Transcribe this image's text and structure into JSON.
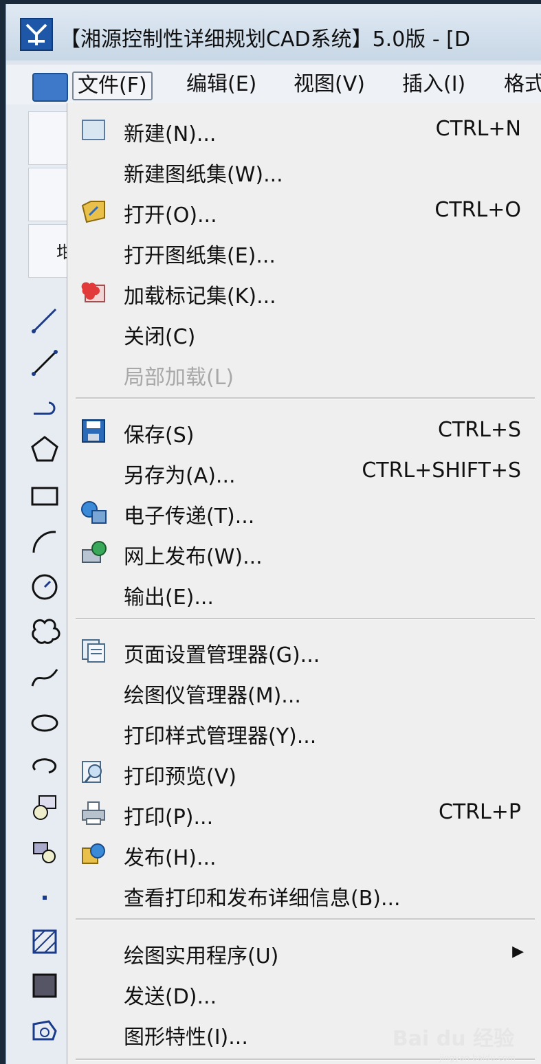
{
  "window": {
    "title": "【湘源控制性详细规划CAD系统】5.0版 - [D"
  },
  "menubar": {
    "items": [
      {
        "label": "文件(F)"
      },
      {
        "label": "编辑(E)"
      },
      {
        "label": "视图(V)"
      },
      {
        "label": "插入(I)"
      },
      {
        "label": "格式"
      }
    ]
  },
  "toolbar": {
    "partial_label": "坩"
  },
  "file_menu": {
    "items": [
      {
        "label": "新建(N)...",
        "shortcut": "CTRL+N",
        "icon": "new-document-icon"
      },
      {
        "label": "新建图纸集(W)...",
        "shortcut": ""
      },
      {
        "label": "打开(O)...",
        "shortcut": "CTRL+O",
        "icon": "open-folder-icon"
      },
      {
        "label": "打开图纸集(E)...",
        "shortcut": ""
      },
      {
        "label": "加载标记集(K)...",
        "shortcut": "",
        "icon": "markup-set-icon"
      },
      {
        "label": "关闭(C)",
        "shortcut": ""
      },
      {
        "label": "局部加载(L)",
        "shortcut": "",
        "disabled": true
      },
      {
        "label": "保存(S)",
        "shortcut": "CTRL+S",
        "icon": "save-icon"
      },
      {
        "label": "另存为(A)...",
        "shortcut": "CTRL+SHIFT+S"
      },
      {
        "label": "电子传递(T)...",
        "shortcut": "",
        "icon": "etransmit-icon"
      },
      {
        "label": "网上发布(W)...",
        "shortcut": "",
        "icon": "publish-web-icon"
      },
      {
        "label": "输出(E)...",
        "shortcut": ""
      },
      {
        "label": "页面设置管理器(G)...",
        "shortcut": "",
        "icon": "page-setup-icon"
      },
      {
        "label": "绘图仪管理器(M)...",
        "shortcut": ""
      },
      {
        "label": "打印样式管理器(Y)...",
        "shortcut": ""
      },
      {
        "label": "打印预览(V)",
        "shortcut": "",
        "icon": "print-preview-icon"
      },
      {
        "label": "打印(P)...",
        "shortcut": "CTRL+P",
        "icon": "printer-icon"
      },
      {
        "label": "发布(H)...",
        "shortcut": "",
        "icon": "publish-icon"
      },
      {
        "label": "查看打印和发布详细信息(B)...",
        "shortcut": ""
      },
      {
        "label": "绘图实用程序(U)",
        "shortcut": "",
        "submenu": true
      },
      {
        "label": "发送(D)...",
        "shortcut": ""
      },
      {
        "label": "图形特性(I)...",
        "shortcut": ""
      }
    ]
  },
  "watermark": {
    "text": "Bai du 经验",
    "subtext": "jingyan.baidu.com"
  }
}
